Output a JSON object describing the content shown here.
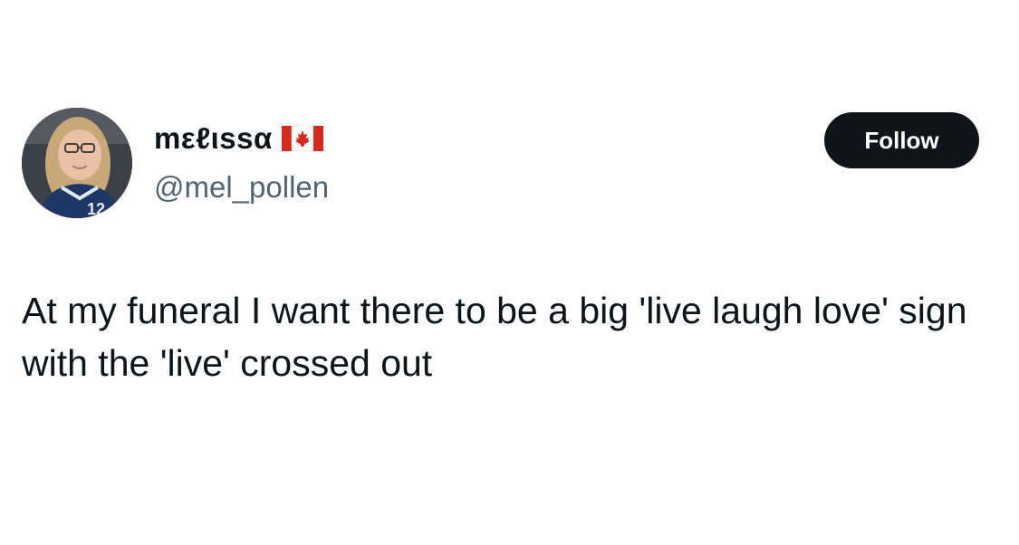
{
  "author": {
    "display_name": "mεℓιssα",
    "flag_icon": "canada-flag-icon",
    "handle": "@mel_pollen"
  },
  "follow_button": {
    "label": "Follow"
  },
  "tweet": {
    "text": "At my funeral I want there to be a big 'live laugh love' sign with the 'live' crossed out"
  },
  "colors": {
    "background": "#ffffff",
    "text": "#0f1419",
    "secondary_text": "#536471",
    "button_bg": "#0f1419",
    "flag_red": "#d52b1e"
  }
}
